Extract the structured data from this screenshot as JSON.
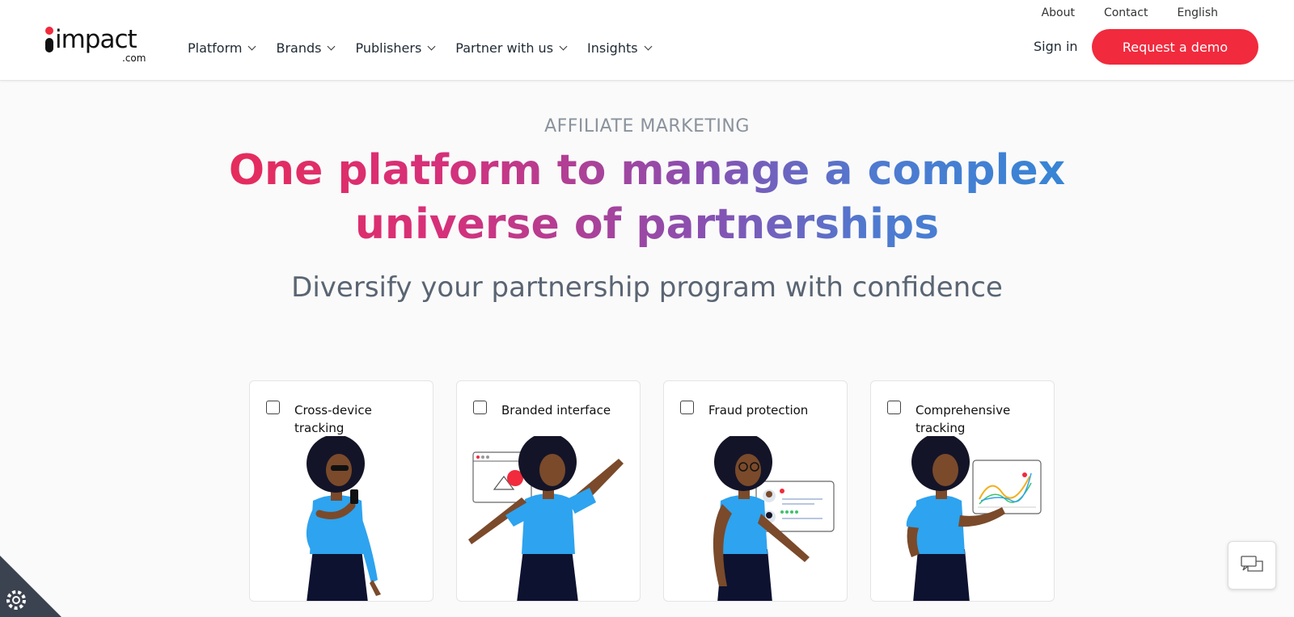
{
  "brand": {
    "word": "impact",
    "suffix": ".com",
    "accent": "#f12a3d"
  },
  "utility_nav": [
    "About",
    "Contact",
    "English"
  ],
  "main_nav": [
    {
      "label": "Platform"
    },
    {
      "label": "Brands"
    },
    {
      "label": "Publishers"
    },
    {
      "label": "Partner with us"
    },
    {
      "label": "Insights"
    }
  ],
  "header": {
    "signin": "Sign in",
    "demo": "Request a demo"
  },
  "hero": {
    "eyebrow": "AFFILIATE MARKETING",
    "headline": "One platform to manage a complex universe of partnerships",
    "subhead": "Diversify your partnership program with confidence"
  },
  "features": [
    {
      "label": "Cross-device tracking",
      "checked": false
    },
    {
      "label": "Branded interface",
      "checked": false
    },
    {
      "label": "Fraud protection",
      "checked": false
    },
    {
      "label": "Comprehensive tracking",
      "checked": false
    }
  ],
  "colors": {
    "shirt": "#2ea3ef",
    "skin": "#7a4a2b",
    "hair": "#141428",
    "pants": "#0d1230"
  }
}
